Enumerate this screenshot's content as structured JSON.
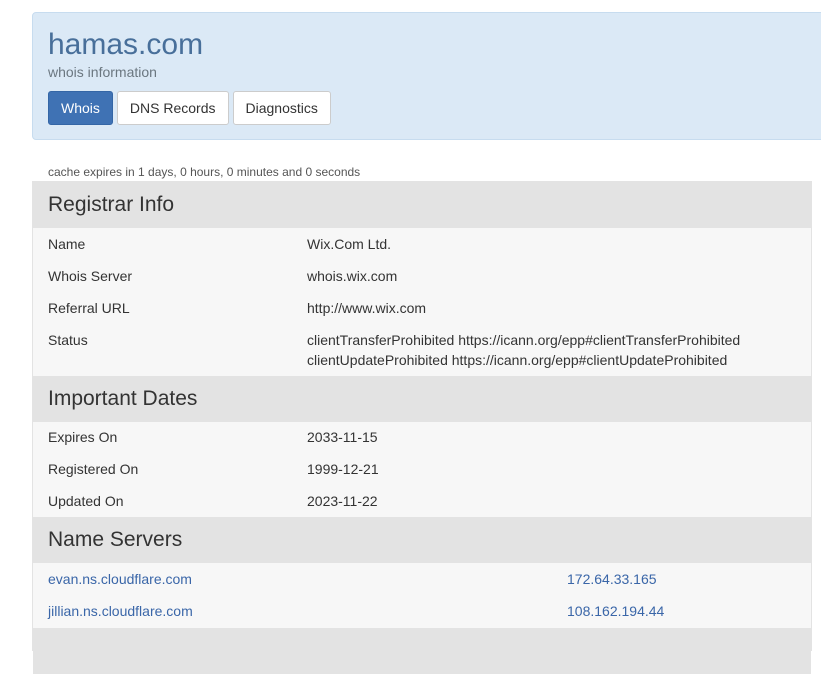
{
  "header": {
    "domain": "hamas.com",
    "subtitle": "whois information",
    "tabs": [
      "Whois",
      "DNS Records",
      "Diagnostics"
    ]
  },
  "cache_note": "cache expires in 1 days, 0 hours, 0 minutes and 0 seconds",
  "registrar": {
    "title": "Registrar Info",
    "name_label": "Name",
    "name_value": "Wix.Com Ltd.",
    "server_label": "Whois Server",
    "server_value": "whois.wix.com",
    "referral_label": "Referral URL",
    "referral_value": "http://www.wix.com",
    "status_label": "Status",
    "status_line1": "clientTransferProhibited https://icann.org/epp#clientTransferProhibited",
    "status_line2": "clientUpdateProhibited https://icann.org/epp#clientUpdateProhibited"
  },
  "dates": {
    "title": "Important Dates",
    "expires_label": "Expires On",
    "expires_value": "2033-11-15",
    "registered_label": "Registered On",
    "registered_value": "1999-12-21",
    "updated_label": "Updated On",
    "updated_value": "2023-11-22"
  },
  "nameservers": {
    "title": "Name Servers",
    "items": [
      {
        "host": "evan.ns.cloudflare.com",
        "ip": "172.64.33.165"
      },
      {
        "host": "jillian.ns.cloudflare.com",
        "ip": "108.162.194.44"
      }
    ]
  },
  "colors": {
    "header_bg": "#dbe9f6",
    "title": "#486f9a",
    "active_tab": "#3f72b4",
    "link": "#3a66a8",
    "section_bg": "#e3e3e3"
  }
}
